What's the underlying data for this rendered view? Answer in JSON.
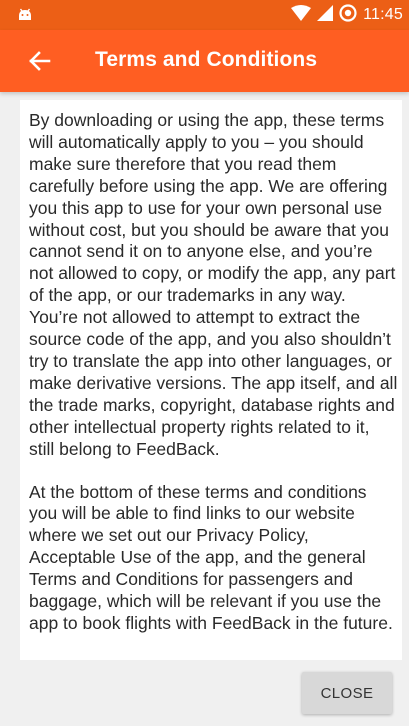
{
  "status_bar": {
    "time": "11:45",
    "icons": [
      "android-icon",
      "wifi-icon",
      "signal-icon",
      "data-saver-icon"
    ]
  },
  "app_bar": {
    "title": "Terms and Conditions",
    "back_icon": "arrow-back-icon"
  },
  "content": {
    "paragraphs": [
      "By downloading or using the app, these terms will automatically apply to you – you should make sure therefore that you read them carefully before using the app. We are offering you this app to use for your own personal use without cost, but you should be aware that you cannot send it on to anyone else, and you’re not allowed to copy, or modify the app, any part of the app, or our trademarks in any way. You’re not allowed to attempt to extract the source code of the app, and you also shouldn’t try to translate the app into other languages, or make derivative versions. The app itself, and all the trade marks, copyright, database rights and other intellectual property rights related to it, still belong to FeedBack.",
      "At the bottom of these terms and conditions you will be able to find links to our website where we set out our Privacy Policy, Acceptable Use of the app, and the general Terms and Conditions for passengers and baggage, which will be relevant if you use the app to book flights with FeedBack in the future."
    ]
  },
  "actions": {
    "close_label": "CLOSE"
  },
  "colors": {
    "status_bar": "#ec5f16",
    "app_bar": "#ff5e22",
    "background": "#f0f0f0",
    "button": "#d8d8d8"
  }
}
